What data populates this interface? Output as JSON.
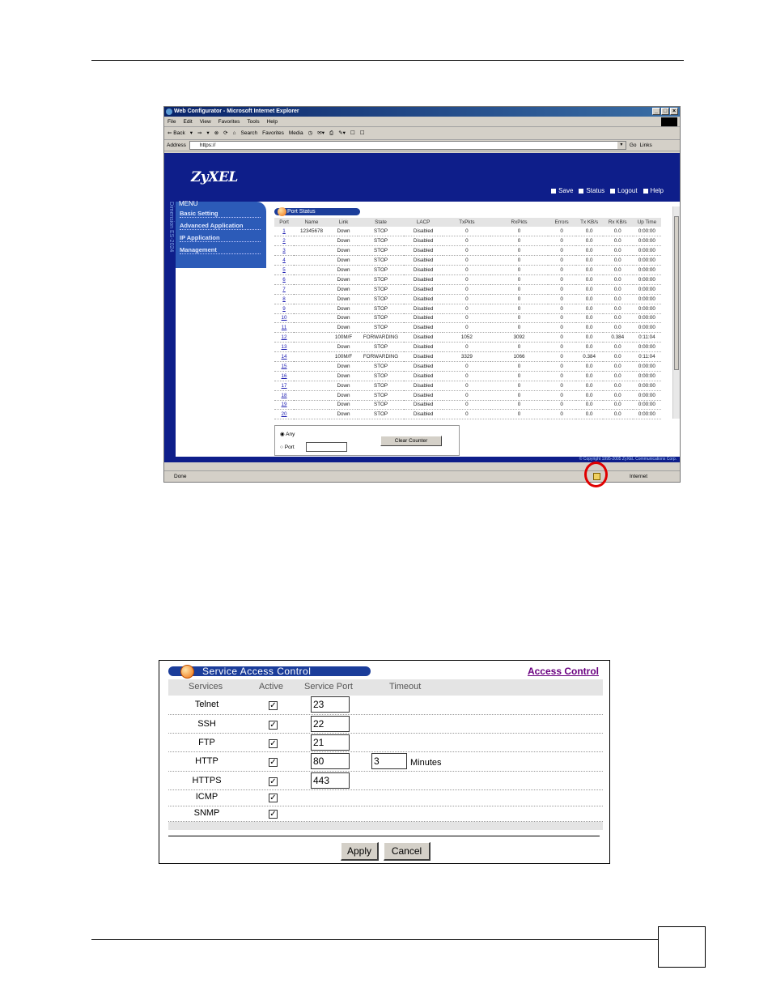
{
  "browser": {
    "title": "Web Configurator - Microsoft Internet Explorer",
    "menu": [
      "File",
      "Edit",
      "View",
      "Favorites",
      "Tools",
      "Help"
    ],
    "toolbar": [
      "⇐ Back",
      "▾",
      "⇒",
      "▾",
      "⊗",
      "⟳",
      "⌂",
      "Search",
      "Favorites",
      "Media",
      "◷",
      "✉▾",
      "⎙",
      "✎▾",
      "☐",
      "☐"
    ],
    "address_label": "Address",
    "address_value": "https://",
    "go_label": "Go",
    "links_label": "Links",
    "status_text": "Done",
    "zone_text": "Internet"
  },
  "zyxel": {
    "logo": "ZyXEL",
    "vertical_text": "Dimension ES-2024",
    "top_links": [
      "Save",
      "Status",
      "Logout",
      "Help"
    ],
    "menu_label": "MENU",
    "menu_items": [
      "Basic Setting",
      "Advanced Application",
      "IP Application",
      "Management"
    ],
    "footer": "© Copyright 1995-2005 ZyXEL Communications Corp."
  },
  "port_status": {
    "title": "Port Status",
    "columns": [
      "Port",
      "Name",
      "Link",
      "State",
      "LACP",
      "TxPkts",
      "RxPkts",
      "Errors",
      "Tx KB/s",
      "Rx KB/s",
      "Up Time"
    ],
    "rows": [
      [
        "1",
        "12345678",
        "Down",
        "STOP",
        "Disabled",
        "0",
        "0",
        "0",
        "0.0",
        "0.0",
        "0:00:00"
      ],
      [
        "2",
        "",
        "Down",
        "STOP",
        "Disabled",
        "0",
        "0",
        "0",
        "0.0",
        "0.0",
        "0:00:00"
      ],
      [
        "3",
        "",
        "Down",
        "STOP",
        "Disabled",
        "0",
        "0",
        "0",
        "0.0",
        "0.0",
        "0:00:00"
      ],
      [
        "4",
        "",
        "Down",
        "STOP",
        "Disabled",
        "0",
        "0",
        "0",
        "0.0",
        "0.0",
        "0:00:00"
      ],
      [
        "5",
        "",
        "Down",
        "STOP",
        "Disabled",
        "0",
        "0",
        "0",
        "0.0",
        "0.0",
        "0:00:00"
      ],
      [
        "6",
        "",
        "Down",
        "STOP",
        "Disabled",
        "0",
        "0",
        "0",
        "0.0",
        "0.0",
        "0:00:00"
      ],
      [
        "7",
        "",
        "Down",
        "STOP",
        "Disabled",
        "0",
        "0",
        "0",
        "0.0",
        "0.0",
        "0:00:00"
      ],
      [
        "8",
        "",
        "Down",
        "STOP",
        "Disabled",
        "0",
        "0",
        "0",
        "0.0",
        "0.0",
        "0:00:00"
      ],
      [
        "9",
        "",
        "Down",
        "STOP",
        "Disabled",
        "0",
        "0",
        "0",
        "0.0",
        "0.0",
        "0:00:00"
      ],
      [
        "10",
        "",
        "Down",
        "STOP",
        "Disabled",
        "0",
        "0",
        "0",
        "0.0",
        "0.0",
        "0:00:00"
      ],
      [
        "11",
        "",
        "Down",
        "STOP",
        "Disabled",
        "0",
        "0",
        "0",
        "0.0",
        "0.0",
        "0:00:00"
      ],
      [
        "12",
        "",
        "100M/F",
        "FORWARDING",
        "Disabled",
        "1052",
        "3092",
        "0",
        "0.0",
        "0.384",
        "0:11:04"
      ],
      [
        "13",
        "",
        "Down",
        "STOP",
        "Disabled",
        "0",
        "0",
        "0",
        "0.0",
        "0.0",
        "0:00:00"
      ],
      [
        "14",
        "",
        "100M/F",
        "FORWARDING",
        "Disabled",
        "3329",
        "1066",
        "0",
        "0.384",
        "0.0",
        "0:11:04"
      ],
      [
        "15",
        "",
        "Down",
        "STOP",
        "Disabled",
        "0",
        "0",
        "0",
        "0.0",
        "0.0",
        "0:00:00"
      ],
      [
        "16",
        "",
        "Down",
        "STOP",
        "Disabled",
        "0",
        "0",
        "0",
        "0.0",
        "0.0",
        "0:00:00"
      ],
      [
        "17",
        "",
        "Down",
        "STOP",
        "Disabled",
        "0",
        "0",
        "0",
        "0.0",
        "0.0",
        "0:00:00"
      ],
      [
        "18",
        "",
        "Down",
        "STOP",
        "Disabled",
        "0",
        "0",
        "0",
        "0.0",
        "0.0",
        "0:00:00"
      ],
      [
        "19",
        "",
        "Down",
        "STOP",
        "Disabled",
        "0",
        "0",
        "0",
        "0.0",
        "0.0",
        "0:00:00"
      ],
      [
        "20",
        "",
        "Down",
        "STOP",
        "Disabled",
        "0",
        "0",
        "0",
        "0.0",
        "0.0",
        "0:00:00"
      ]
    ],
    "radio_any": "Any",
    "radio_port": "Port",
    "clear_button": "Clear Counter"
  },
  "service_access": {
    "title": "Service Access Control",
    "link": "Access Control",
    "columns": [
      "Services",
      "Active",
      "Service Port",
      "Timeout"
    ],
    "rows": [
      {
        "service": "Telnet",
        "active": true,
        "port": "23",
        "timeout": "",
        "unit": ""
      },
      {
        "service": "SSH",
        "active": true,
        "port": "22",
        "timeout": "",
        "unit": ""
      },
      {
        "service": "FTP",
        "active": true,
        "port": "21",
        "timeout": "",
        "unit": ""
      },
      {
        "service": "HTTP",
        "active": true,
        "port": "80",
        "timeout": "3",
        "unit": "Minutes"
      },
      {
        "service": "HTTPS",
        "active": true,
        "port": "443",
        "timeout": "",
        "unit": ""
      },
      {
        "service": "ICMP",
        "active": true,
        "port": "",
        "timeout": "",
        "unit": ""
      },
      {
        "service": "SNMP",
        "active": true,
        "port": "",
        "timeout": "",
        "unit": ""
      }
    ],
    "apply": "Apply",
    "cancel": "Cancel"
  },
  "colors": {
    "zyxel_blue": "#0e1e8a",
    "title_bar_blue": "#1b3d9a",
    "link_purple": "#6a0080",
    "highlight_red": "#e00000"
  }
}
